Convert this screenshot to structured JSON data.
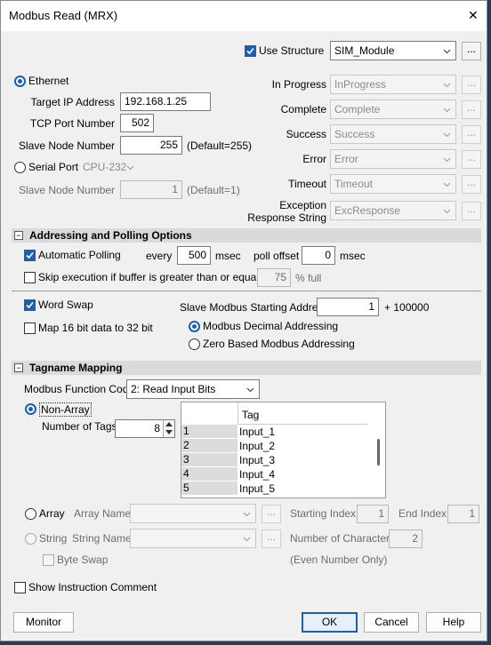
{
  "window": {
    "title": "Modbus Read (MRX)",
    "close": "✕"
  },
  "top": {
    "use_structure": {
      "label": "Use Structure",
      "checked": true
    },
    "structure": {
      "value": "SIM_Module"
    },
    "ellipsis": "..."
  },
  "ethernet": {
    "label": "Ethernet",
    "target_ip_label": "Target IP Address",
    "target_ip": "192.168.1.25",
    "tcp_port_label": "TCP Port Number",
    "tcp_port": "502",
    "slave_node_label": "Slave Node Number",
    "slave_node": "255",
    "slave_node_note": "(Default=255)"
  },
  "serial": {
    "label": "Serial Port",
    "port": "CPU-232",
    "slave_node_label": "Slave Node Number",
    "slave_node": "1",
    "slave_node_note": "(Default=1)"
  },
  "status": [
    {
      "label": "In Progress",
      "value": "InProgress"
    },
    {
      "label": "Complete",
      "value": "Complete"
    },
    {
      "label": "Success",
      "value": "Success"
    },
    {
      "label": "Error",
      "value": "Error"
    },
    {
      "label": "Timeout",
      "value": "Timeout"
    }
  ],
  "exception": {
    "label1": "Exception",
    "label2": "Response String",
    "value": "ExcResponse"
  },
  "addressing": {
    "title": "Addressing and Polling Options",
    "toggle": "−",
    "auto_polling": "Automatic Polling",
    "every": "every",
    "every_value": "500",
    "msec": "msec",
    "poll_offset": "poll offset",
    "poll_offset_value": "0",
    "msec2": "msec",
    "skip": "Skip execution if buffer is greater than or equal to",
    "skip_value": "75",
    "pct_full": "% full",
    "word_swap": "Word Swap",
    "map16": "Map 16 bit data to 32 bit",
    "slave_start_label": "Slave Modbus Starting Address",
    "slave_start": "1",
    "plus": "+ 100000",
    "decimal": "Modbus Decimal Addressing",
    "zero_based": "Zero Based Modbus Addressing"
  },
  "tagname": {
    "title": "Tagname Mapping",
    "toggle": "−",
    "func_label": "Modbus Function Code",
    "func": "2: Read Input Bits",
    "non_array": "Non-Array",
    "num_tags_label": "Number of Tags",
    "num_tags": "8",
    "col_tag": "Tag",
    "rows": [
      {
        "n": "1",
        "tag": "Input_1"
      },
      {
        "n": "2",
        "tag": "Input_2"
      },
      {
        "n": "3",
        "tag": "Input_3"
      },
      {
        "n": "4",
        "tag": "Input_4"
      },
      {
        "n": "5",
        "tag": "Input_5"
      }
    ],
    "array": "Array",
    "array_name": "Array Name",
    "starting_index": "Starting Index",
    "starting_index_value": "1",
    "end_index": "End Index",
    "end_index_value": "1",
    "string": "String",
    "string_name": "String Name",
    "num_chars": "Number of Characters",
    "num_chars_value": "2",
    "byte_swap": "Byte Swap",
    "even_only": "(Even Number Only)"
  },
  "footer": {
    "show_comment": "Show Instruction Comment",
    "monitor": "Monitor",
    "ok": "OK",
    "cancel": "Cancel",
    "help": "Help"
  },
  "colors": {
    "accent": "#1a5fb4",
    "section": "#dadada",
    "dialog_bg": "#f0f0f0"
  }
}
